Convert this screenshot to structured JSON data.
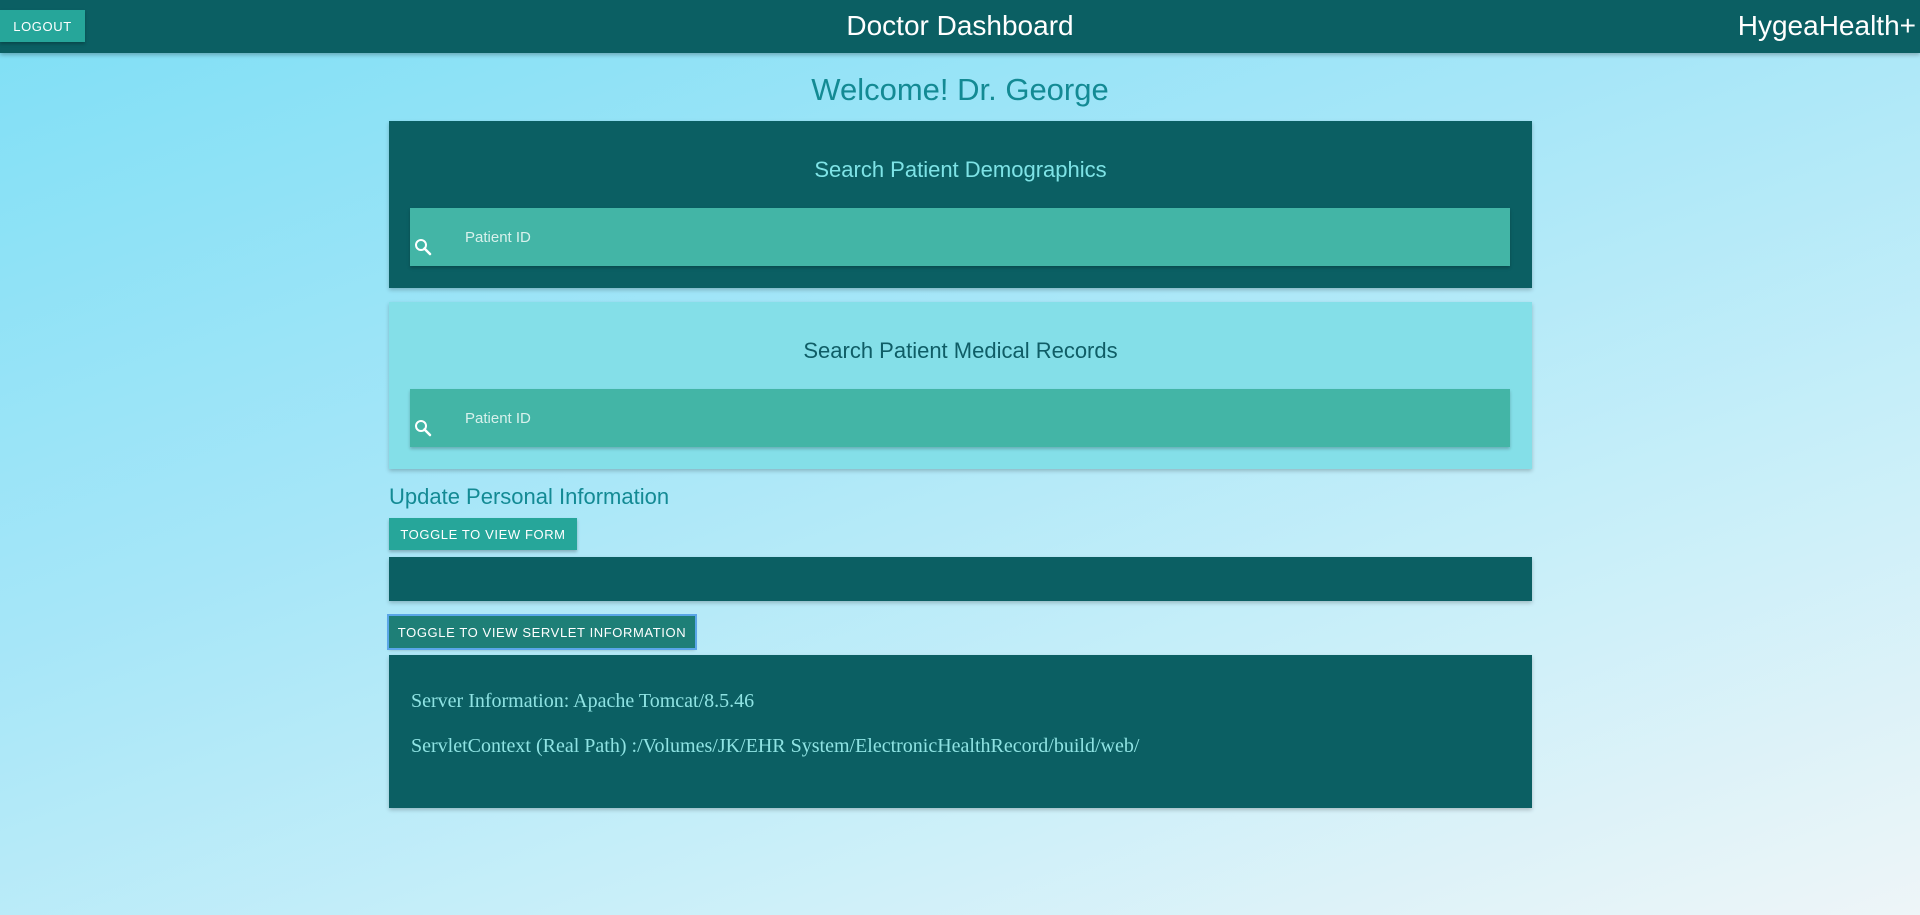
{
  "header": {
    "logout_label": "LOGOUT",
    "title": "Doctor Dashboard",
    "brand": "HygeaHealth+"
  },
  "welcome": "Welcome! Dr. George",
  "demographics_search": {
    "title": "Search Patient Demographics",
    "placeholder": "Patient ID",
    "icon": "search-icon"
  },
  "records_search": {
    "title": "Search Patient Medical Records",
    "placeholder": "Patient ID",
    "icon": "search-icon"
  },
  "personal_info": {
    "heading": "Update Personal Information",
    "toggle_form_label": "TOGGLE TO VIEW FORM"
  },
  "servlet": {
    "toggle_label": "TOGGLE TO VIEW SERVLET INFORMATION",
    "server_info": "Server Information: Apache Tomcat/8.5.46",
    "context_path": "ServletContext (Real Path) :/Volumes/JK/EHR System/ElectronicHealthRecord/build/web/"
  },
  "colors": {
    "nav": "#0b5f63",
    "accent": "#26a69a",
    "search_field": "#43b5a6",
    "light_card": "#84dfe8",
    "heading_text": "#138a94"
  }
}
